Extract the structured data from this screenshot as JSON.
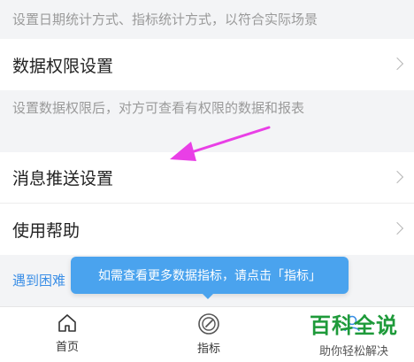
{
  "hints": {
    "date_settings_hint": "设置日期统计方式、指标统计方式，以符合实际场景",
    "permission_hint": "设置数据权限后，对方可查看有权限的数据和报表"
  },
  "rows": {
    "permission": "数据权限设置",
    "push": "消息推送设置",
    "help": "使用帮助"
  },
  "link_strip": {
    "text": "遇到困难"
  },
  "tooltip": {
    "text": "如需查看更多数据指标，请点击「指标」"
  },
  "tabbar": {
    "home": "首页",
    "metrics": "指标",
    "active_color": "#3a8ee6"
  },
  "watermark": {
    "title": "百科全说",
    "subtitle": "助你轻松解决"
  },
  "colors": {
    "annotation_arrow": "#e93fe6",
    "tooltip_bg": "#4aa3ee",
    "watermark_green": "#1e9a3a"
  }
}
